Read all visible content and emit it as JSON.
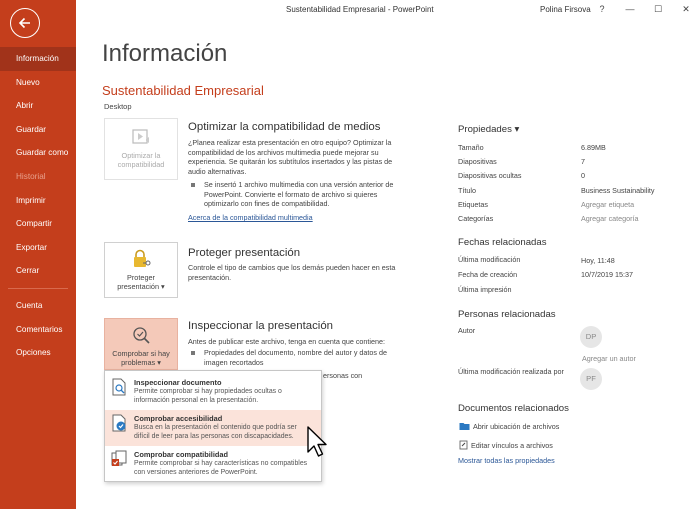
{
  "titlebar": {
    "title": "Sustentabilidad Empresarial  -  PowerPoint",
    "user": "Polina Firsova",
    "help": "?",
    "minimize": "—",
    "maximize": "☐",
    "close": "✕"
  },
  "sidebar": {
    "back_icon": "back-arrow-icon",
    "items": [
      {
        "label": "Información",
        "state": "active"
      },
      {
        "label": "Nuevo",
        "state": "normal"
      },
      {
        "label": "Abrir",
        "state": "normal"
      },
      {
        "label": "Guardar",
        "state": "normal"
      },
      {
        "label": "Guardar como",
        "state": "normal"
      },
      {
        "label": "Historial",
        "state": "disabled"
      },
      {
        "label": "Imprimir",
        "state": "normal"
      },
      {
        "label": "Compartir",
        "state": "normal"
      },
      {
        "label": "Exportar",
        "state": "normal"
      },
      {
        "label": "Cerrar",
        "state": "normal"
      }
    ],
    "bottom_items": [
      {
        "label": "Cuenta"
      },
      {
        "label": "Comentarios"
      },
      {
        "label": "Opciones"
      }
    ]
  },
  "main": {
    "page_title": "Información",
    "doc_title": "Sustentabilidad Empresarial",
    "doc_location": "Desktop",
    "media": {
      "tile_label": "Optimizar la compatibilidad",
      "heading": "Optimizar la compatibilidad de medios",
      "text": "¿Planea realizar esta presentación en otro equipo? Optimizar la compatibilidad de los archivos multimedia puede mejorar su experiencia. Se quitarán los subtítulos insertados y las pistas de audio alternativas.",
      "bullet": "Se insertó 1 archivo multimedia con una versión anterior de PowerPoint. Convierte el formato de archivo si quieres optimizarlo con fines de compatibilidad.",
      "link": "Acerca de la compatibilidad multimedia"
    },
    "protect": {
      "tile_label": "Proteger presentación ▾",
      "heading": "Proteger presentación",
      "text": "Controle el tipo de cambios que los demás pueden hacer en esta presentación."
    },
    "inspect": {
      "tile_label": "Comprobar si hay problemas ▾",
      "heading": "Inspeccionar la presentación",
      "text": "Antes de publicar este archivo, tenga en cuenta que contiene:",
      "bullet1": "Propiedades del documento, nombre del autor y datos de imagen recortados",
      "bullet2_tail": "ersonas con"
    }
  },
  "menu": {
    "items": [
      {
        "title": "Inspeccionar documento",
        "desc": "Permite comprobar si hay propiedades ocultas o información personal en la presentación.",
        "icon": "inspect-document-icon"
      },
      {
        "title": "Comprobar accesibilidad",
        "desc": "Busca en la presentación el contenido que podría ser difícil de leer para las personas con discapacidades.",
        "icon": "accessibility-check-icon"
      },
      {
        "title": "Comprobar compatibilidad",
        "desc": "Permite comprobar si hay características no compatibles con versiones anteriores de PowerPoint.",
        "icon": "compatibility-check-icon"
      }
    ]
  },
  "properties": {
    "heading": "Propiedades ▾",
    "rows": [
      {
        "key": "Tamaño",
        "value": "6.89MB",
        "muted": false
      },
      {
        "key": "Diapositivas",
        "value": "7",
        "muted": false
      },
      {
        "key": "Diapositivas ocultas",
        "value": "0",
        "muted": false
      },
      {
        "key": "Título",
        "value": "Business Sustainability",
        "muted": false
      },
      {
        "key": "Etiquetas",
        "value": "Agregar etiqueta",
        "muted": true
      },
      {
        "key": "Categorías",
        "value": "Agregar categoría",
        "muted": true
      }
    ]
  },
  "dates": {
    "heading": "Fechas relacionadas",
    "rows": [
      {
        "key": "Última modificación",
        "value": "Hoy, 11:48"
      },
      {
        "key": "Fecha de creación",
        "value": "10/7/2019 15:37"
      },
      {
        "key": "Última impresión",
        "value": ""
      }
    ]
  },
  "people": {
    "heading": "Personas relacionadas",
    "author_label": "Autor",
    "author_initials": "DP",
    "add_author": "Agregar un autor",
    "modified_by_label": "Última modificación realizada por",
    "modified_initials": "PF"
  },
  "related_docs": {
    "heading": "Documentos relacionados",
    "open_location": "Abrir ubicación de archivos",
    "edit_links": "Editar vínculos a archivos",
    "show_all": "Mostrar todas las propiedades"
  },
  "colors": {
    "accent": "#c43e1c",
    "accent_dark": "#a1331a",
    "tile_active": "#f4c9b9",
    "menu_hover": "#fbe3da",
    "link": "#2b5797"
  }
}
